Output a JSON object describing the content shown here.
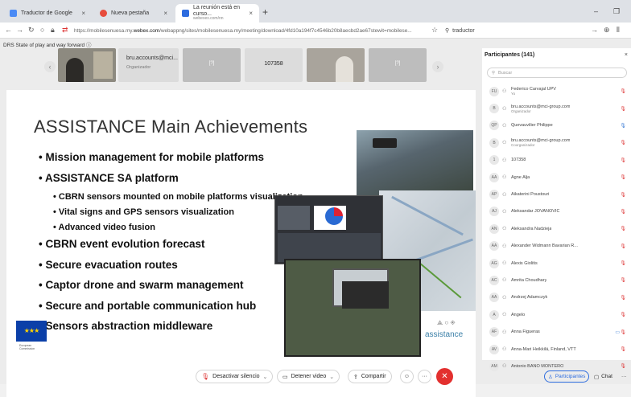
{
  "browser": {
    "tabs": [
      {
        "title": "Traductor de Google",
        "color": "#4b8bf5"
      },
      {
        "title": "Nueva pestaña",
        "color": "#e74c3c"
      },
      {
        "title": "La reunión está en curso...",
        "subtitle": "webexex.com/nn",
        "color": "#2d6cdf"
      }
    ],
    "new_tab": "+",
    "url_prefix": "https://mobilesenuesa.my.",
    "url_host": "webex.com",
    "url_rest": "/webappng/sites/mobilesenuesa.my/meeting/download/4fd10a194f7c4546b20b8aecbd2ae67stewit=mobilese...",
    "search_text": "traductor"
  },
  "meeting": {
    "title": "DRS State of play and way forward",
    "strip": [
      {
        "type": "video",
        "key": "cam1"
      },
      {
        "type": "name",
        "name": "bru.accounts@mci...",
        "role": "Organizador"
      },
      {
        "type": "icon",
        "label": "[?]"
      },
      {
        "type": "number",
        "label": "107358"
      },
      {
        "type": "video",
        "key": "cam2"
      },
      {
        "type": "icon",
        "label": "[?]"
      }
    ]
  },
  "slide": {
    "title": "ASSISTANCE Main Achievements",
    "bullets": [
      {
        "level": 1,
        "text": "Mission management for mobile platforms"
      },
      {
        "level": 1,
        "text": "ASSISTANCE SA platform"
      },
      {
        "level": 2,
        "text": "CBRN sensors mounted on mobile platforms visualization"
      },
      {
        "level": 2,
        "text": "Vital signs and GPS sensors visualization"
      },
      {
        "level": 2,
        "text": "Advanced video fusion"
      },
      {
        "level": 1,
        "text": "CBRN event evolution forecast"
      },
      {
        "level": 1,
        "text": "Secure evacuation routes"
      },
      {
        "level": 1,
        "text": "Captor drone and swarm management"
      },
      {
        "level": 1,
        "text": "Secure and portable communication hub"
      },
      {
        "level": 1,
        "text": "Sensors abstraction middleware"
      }
    ],
    "logo": "assistance",
    "eu_text": "European Commission"
  },
  "participants": {
    "header": "Participantes (141)",
    "close": "×",
    "search_placeholder": "Buscar",
    "list": [
      {
        "initials": "FU",
        "name": "Federico Carvajal UPV",
        "role": "Yo",
        "mic": "off"
      },
      {
        "initials": "B",
        "name": "bru.accounts@mci-group.com",
        "role": "Organizador",
        "mic": "off"
      },
      {
        "initials": "QP",
        "name": "Quevauvilier Philippe",
        "role": "",
        "mic": "on"
      },
      {
        "initials": "B",
        "name": "bru.accounts@mci-group.com",
        "role": "Coorganizador",
        "mic": "off"
      },
      {
        "initials": "1",
        "name": "107358",
        "role": "",
        "mic": "off"
      },
      {
        "initials": "AA",
        "name": "Agne Alja",
        "role": "",
        "mic": "off"
      },
      {
        "initials": "AP",
        "name": "Aikaterini Poustouri",
        "role": "",
        "mic": "off"
      },
      {
        "initials": "AJ",
        "name": "Aleksandar JOVANOVIC",
        "role": "",
        "mic": "off"
      },
      {
        "initials": "AN",
        "name": "Aleksandra Nadzieja",
        "role": "",
        "mic": "off"
      },
      {
        "initials": "AA",
        "name": "Alexander Widmann Bavarian R...",
        "role": "",
        "mic": "off"
      },
      {
        "initials": "AG",
        "name": "Alexis Giolitis",
        "role": "",
        "mic": "off"
      },
      {
        "initials": "AC",
        "name": "Amrita Choudhary",
        "role": "",
        "mic": "off"
      },
      {
        "initials": "AA",
        "name": "Andrzej Adamczyk",
        "role": "",
        "mic": "off"
      },
      {
        "initials": "A",
        "name": "Angelo",
        "role": "",
        "mic": "off"
      },
      {
        "initials": "AF",
        "name": "Anna Figueras",
        "role": "",
        "mic": "off",
        "cam": true
      },
      {
        "initials": "AV",
        "name": "Anna-Mari Heikkilä, Finland, VTT",
        "role": "",
        "mic": "off"
      },
      {
        "initials": "AM",
        "name": "Antonio BAÑO MONTERO",
        "role": "",
        "mic": "off"
      }
    ]
  },
  "controls": {
    "mute": "Desactivar silencio",
    "video": "Detener video",
    "share": "Compartir",
    "participants": "Participantes",
    "chat": "Chat",
    "more": "···"
  }
}
